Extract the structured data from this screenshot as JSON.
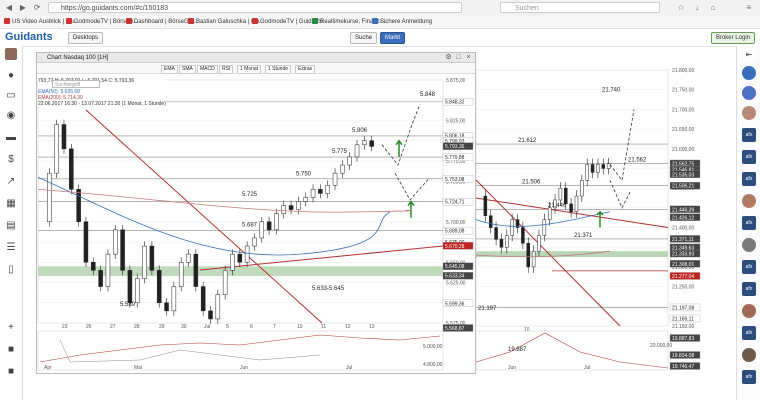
{
  "browser": {
    "url": "https://go.guidants.com/#c/150183",
    "search_placeholder": "Suchen",
    "bookmarks": [
      "US Video Ausblick | Gu...",
      "GodmodeTV | BörseG...",
      "Dashboard | BörseGo ...",
      "Bastian Galuschka | Gu...",
      "GodmodeTV | Guidants",
      "Realtimekurse, Finanz-...",
      "Sichere Anmeldung"
    ]
  },
  "app": {
    "logo": "Guidants",
    "desktop_tab": "Desktops",
    "search_label": "Suche",
    "markt_label": "Markt",
    "broker_login": "Broker Login"
  },
  "chart": {
    "window_title": "Chart Nasdaq 100 [1H]",
    "toolbar": [
      "EMA",
      "SMA",
      "MACD",
      "RSI",
      "1 Monat",
      "1 Stunde",
      "Extras"
    ],
    "search_placeholder": "Suchbegriff",
    "legend": [
      "793,77  H: 5.797,91  L: 5.791,54  C: 5.793,36",
      "EMA(50): 5.695,58",
      "EMA(200): 5.714,30",
      "22.06.2017 16:30 - 13.07.2017 21:30  (1 Monat, 1 Stunde)"
    ]
  },
  "chart_data": [
    {
      "type": "candlestick",
      "title": "Chart Nasdaq 100 [1H]",
      "x_ticks_top": [
        "23",
        "26",
        "27",
        "28",
        "29",
        "30",
        "Jul",
        "5",
        "6",
        "7",
        "10",
        "11",
        "12",
        "13"
      ],
      "x_ticks_bottom": [
        "Apr",
        "Mai",
        "Jun",
        "Jul"
      ],
      "ylim": [
        5575,
        5875
      ],
      "y_ticks": [
        "5.875,00",
        "5.850,00",
        "5.825,00",
        "5.800,00",
        "5.775,00",
        "5.750,00",
        "5.725,00",
        "5.700,00",
        "5.675,00",
        "5.650,00",
        "5.625,00",
        "5.600,00",
        "5.575,00"
      ],
      "price_labels": [
        {
          "value": 5848.32,
          "text": "5.848,32"
        },
        {
          "value": 5806.18,
          "text": "5.806,18"
        },
        {
          "value": 5799.93,
          "text": "5.799,93"
        },
        {
          "value": 5793.36,
          "text": "5.793,36"
        },
        {
          "value": 5779.88,
          "text": "5.779,88"
        },
        {
          "value": 5753.08,
          "text": "5.753,08"
        },
        {
          "value": 5724.71,
          "text": "5.724,71"
        },
        {
          "value": 5689.08,
          "text": "5.689,08"
        },
        {
          "value": 5675.0,
          "text": "5.675,00"
        },
        {
          "value": 5670.28,
          "text": "5.670,28"
        },
        {
          "value": 5645.08,
          "text": "5.645,08"
        },
        {
          "value": 5633.34,
          "text": "5.633,34"
        },
        {
          "value": 5599.36,
          "text": "5.599,36"
        },
        {
          "value": 5568.87,
          "text": "5.568,87"
        }
      ],
      "level_annotations": [
        "5.848",
        "5.806",
        "5.775",
        "5.750",
        "5.725",
        "5.687",
        "5.633-5.645",
        "5.589"
      ],
      "lower_pane": {
        "y_ticks": [
          "5.000,00",
          "4.800,00"
        ]
      }
    },
    {
      "type": "candlestick",
      "ylim": [
        21150,
        21800
      ],
      "y_ticks": [
        "21.800,00",
        "21.750,00",
        "21.700,00",
        "21.650,00",
        "21.600,00",
        "21.550,00",
        "21.500,00",
        "21.450,00",
        "21.400,00",
        "21.350,00",
        "21.300,00",
        "21.250,00",
        "21.200,00",
        "21.150,00"
      ],
      "price_labels": [
        {
          "value": 21562.75,
          "text": "21.562,75"
        },
        {
          "value": 21546.81,
          "text": "21.546,81"
        },
        {
          "value": 21535.03,
          "text": "21.535,03"
        },
        {
          "value": 21506.21,
          "text": "21.506,21"
        },
        {
          "value": 21446.39,
          "text": "21.446,39"
        },
        {
          "value": 21426.12,
          "text": "21.426,12"
        },
        {
          "value": 21371.11,
          "text": "21.371,11"
        },
        {
          "value": 21349.63,
          "text": "21.349,63"
        },
        {
          "value": 21333.93,
          "text": "21.333,93"
        },
        {
          "value": 21308.01,
          "text": "21.308,01"
        },
        {
          "value": 21277.04,
          "text": "21.277,04"
        },
        {
          "value": 21197.08,
          "text": "21.197,08"
        },
        {
          "value": 21169.11,
          "text": "21.169,11"
        }
      ],
      "level_annotations": [
        "21.740",
        "21.612",
        "21.562",
        "21.506",
        "21.446",
        "21.371",
        "21.197"
      ],
      "x_ticks_top": [
        "10"
      ],
      "x_ticks_bottom": [
        "Jun",
        "Jul"
      ],
      "lower_pane": {
        "price_labels": [
          "19.887,83",
          "19.834,08",
          "19.746,47"
        ],
        "y_ticks": [
          "20.000,00"
        ],
        "annotation": "19.887"
      }
    }
  ]
}
